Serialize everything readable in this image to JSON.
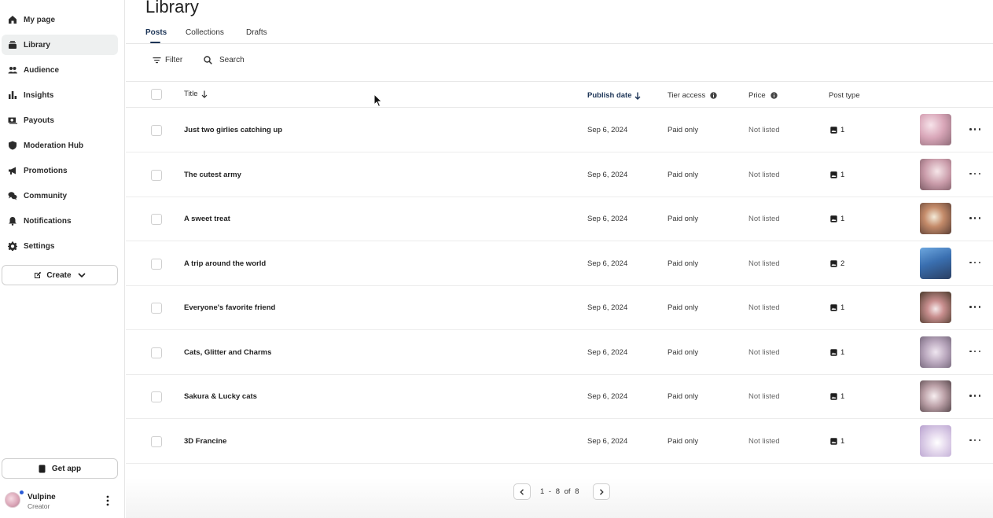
{
  "sidebar": {
    "items": [
      {
        "label": "My page",
        "icon": "home-icon"
      },
      {
        "label": "Library",
        "icon": "library-icon",
        "active": true
      },
      {
        "label": "Audience",
        "icon": "people-icon"
      },
      {
        "label": "Insights",
        "icon": "bar-chart-icon"
      },
      {
        "label": "Payouts",
        "icon": "money-icon"
      },
      {
        "label": "Moderation Hub",
        "icon": "shield-icon"
      },
      {
        "label": "Promotions",
        "icon": "megaphone-icon"
      },
      {
        "label": "Community",
        "icon": "chat-icon"
      },
      {
        "label": "Notifications",
        "icon": "bell-icon"
      },
      {
        "label": "Settings",
        "icon": "gear-icon"
      }
    ],
    "create_label": "Create",
    "get_app_label": "Get app",
    "user": {
      "name": "Vulpine",
      "role": "Creator"
    }
  },
  "main": {
    "title": "Library",
    "tabs": [
      {
        "label": "Posts",
        "active": true
      },
      {
        "label": "Collections"
      },
      {
        "label": "Drafts"
      }
    ],
    "toolbar": {
      "filter_label": "Filter",
      "search_label": "Search"
    },
    "columns": {
      "title": "Title",
      "publish_date": "Publish date",
      "tier_access": "Tier access",
      "price": "Price",
      "post_type": "Post type"
    },
    "rows": [
      {
        "title": "Just two girlies catching up",
        "date": "Sep 6, 2024",
        "tier": "Paid only",
        "price": "Not listed",
        "count": "1"
      },
      {
        "title": "The cutest army",
        "date": "Sep 6, 2024",
        "tier": "Paid only",
        "price": "Not listed",
        "count": "1"
      },
      {
        "title": "A sweet treat",
        "date": "Sep 6, 2024",
        "tier": "Paid only",
        "price": "Not listed",
        "count": "1"
      },
      {
        "title": "A trip around the world",
        "date": "Sep 6, 2024",
        "tier": "Paid only",
        "price": "Not listed",
        "count": "2"
      },
      {
        "title": "Everyone's favorite friend",
        "date": "Sep 6, 2024",
        "tier": "Paid only",
        "price": "Not listed",
        "count": "1"
      },
      {
        "title": "Cats, Glitter and Charms",
        "date": "Sep 6, 2024",
        "tier": "Paid only",
        "price": "Not listed",
        "count": "1"
      },
      {
        "title": "Sakura & Lucky cats",
        "date": "Sep 6, 2024",
        "tier": "Paid only",
        "price": "Not listed",
        "count": "1"
      },
      {
        "title": "3D Francine",
        "date": "Sep 6, 2024",
        "tier": "Paid only",
        "price": "Not listed",
        "count": "1"
      }
    ],
    "pagination": {
      "text": "1 - 8 of 8"
    }
  },
  "colors": {
    "accent": "#1d3557",
    "active_nav_bg": "#eef0f0",
    "border": "#e6e6e6"
  }
}
